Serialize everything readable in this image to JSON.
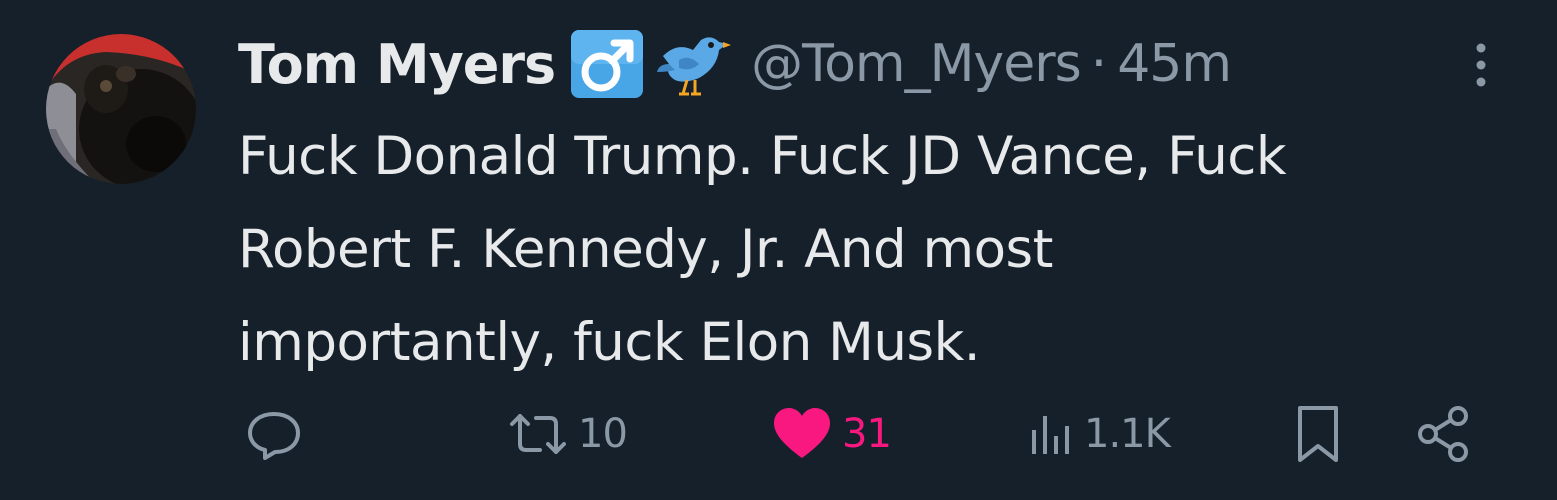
{
  "tweet": {
    "display_name": "Tom Myers",
    "handle": "@Tom_Myers",
    "separator": "·",
    "time": "45m",
    "badges": [
      "male-sign-emoji",
      "bird-emoji"
    ],
    "text_lines": [
      "Fuck Donald Trump. Fuck JD Vance, Fuck",
      "Robert F. Kennedy, Jr. And most",
      "importantly, fuck Elon Musk."
    ],
    "stats": {
      "replies": "",
      "retweets": "10",
      "likes": "31",
      "views": "1.1K"
    },
    "liked": true
  },
  "icons": {
    "reply": "speech-bubble-icon",
    "retweet": "retweet-arrows-icon",
    "like": "heart-icon",
    "views": "bar-chart-icon",
    "bookmark": "bookmark-icon",
    "share": "share-icon",
    "more": "vertical-ellipsis-icon"
  },
  "colors": {
    "background": "#15202b",
    "text": "#e7e9ea",
    "muted": "#8b98a5",
    "like": "#f91880"
  }
}
